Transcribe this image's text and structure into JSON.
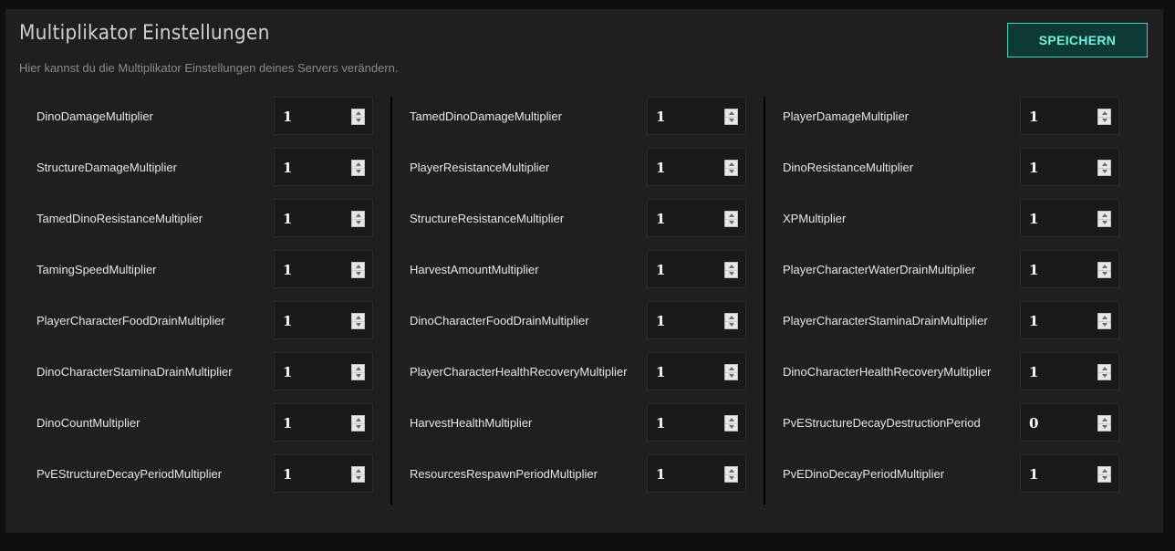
{
  "header": {
    "title": "Multiplikator Einstellungen",
    "subtitle": "Hier kannst du die Multiplikator Einstellungen deines Servers verändern.",
    "save_label": "SPEICHERN"
  },
  "colors": {
    "panel_bg": "#1f1f1f",
    "accent": "#6ff3df",
    "button_bg": "#0d3a35"
  },
  "columns": [
    {
      "fields": [
        {
          "label": "DinoDamageMultiplier",
          "value": "1"
        },
        {
          "label": "StructureDamageMultiplier",
          "value": "1"
        },
        {
          "label": "TamedDinoResistanceMultiplier",
          "value": "1"
        },
        {
          "label": "TamingSpeedMultiplier",
          "value": "1"
        },
        {
          "label": "PlayerCharacterFoodDrainMultiplier",
          "value": "1"
        },
        {
          "label": "DinoCharacterStaminaDrainMultiplier",
          "value": "1"
        },
        {
          "label": "DinoCountMultiplier",
          "value": "1"
        },
        {
          "label": "PvEStructureDecayPeriodMultiplier",
          "value": "1"
        }
      ]
    },
    {
      "fields": [
        {
          "label": "TamedDinoDamageMultiplier",
          "value": "1"
        },
        {
          "label": "PlayerResistanceMultiplier",
          "value": "1"
        },
        {
          "label": "StructureResistanceMultiplier",
          "value": "1"
        },
        {
          "label": "HarvestAmountMultiplier",
          "value": "1"
        },
        {
          "label": "DinoCharacterFoodDrainMultiplier",
          "value": "1"
        },
        {
          "label": "PlayerCharacterHealthRecoveryMultiplier",
          "value": "1"
        },
        {
          "label": "HarvestHealthMultiplier",
          "value": "1"
        },
        {
          "label": "ResourcesRespawnPeriodMultiplier",
          "value": "1"
        }
      ]
    },
    {
      "fields": [
        {
          "label": "PlayerDamageMultiplier",
          "value": "1"
        },
        {
          "label": "DinoResistanceMultiplier",
          "value": "1"
        },
        {
          "label": "XPMultiplier",
          "value": "1"
        },
        {
          "label": "PlayerCharacterWaterDrainMultiplier",
          "value": "1"
        },
        {
          "label": "PlayerCharacterStaminaDrainMultiplier",
          "value": "1"
        },
        {
          "label": "DinoCharacterHealthRecoveryMultiplier",
          "value": "1"
        },
        {
          "label": "PvEStructureDecayDestructionPeriod",
          "value": "0"
        },
        {
          "label": "PvEDinoDecayPeriodMultiplier",
          "value": "1"
        }
      ]
    }
  ]
}
